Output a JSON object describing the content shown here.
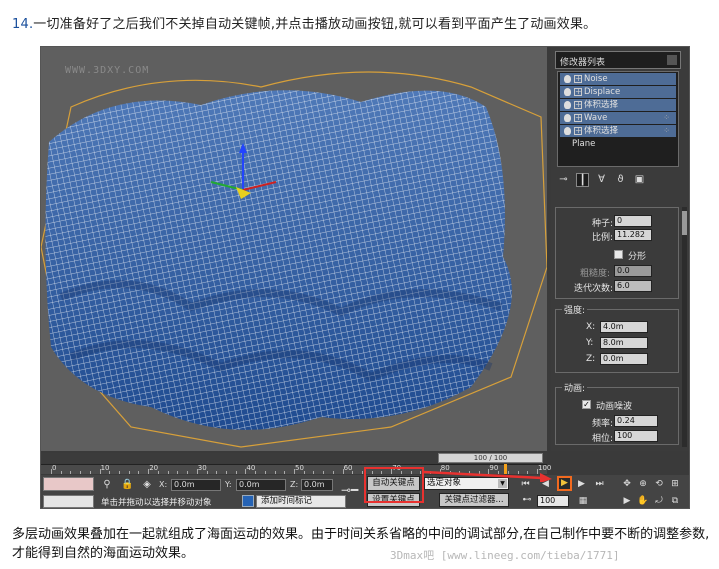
{
  "tutorial": {
    "step_number": "14.",
    "step_text": "一切准备好了之后我们不关掉自动关键帧,并点击播放动画按钮,就可以看到平面产生了动画效果。",
    "closing_text": "多层动画效果叠加在一起就组成了海面运动的效果。由于时间关系省略的中间的调试部分,在自己制作中要不断的调整参数,才能得到自然的海面运动效果。",
    "credit": "3Dmax吧 [www.lineeg.com/tieba/1771]"
  },
  "viewport": {
    "watermark": "WWW.3DXY.COM",
    "mesh_color": "#2f5ea8",
    "wire_color": "#ffffff"
  },
  "command_panel": {
    "object_name": "修改器列表",
    "stack": [
      {
        "label": "Noise",
        "selected": true
      },
      {
        "label": "Displace",
        "selected": false
      },
      {
        "label": "体积选择",
        "selected": false
      },
      {
        "label": "Wave",
        "selected": false
      },
      {
        "label": "体积选择",
        "selected": false
      },
      {
        "label": "Plane",
        "selected": false
      }
    ],
    "noise_params": {
      "seed_label": "种子:",
      "seed_value": "0",
      "scale_label": "比例:",
      "scale_value": "11.282",
      "fractal_label": "分形",
      "roughness_label": "粗糙度:",
      "roughness_value": "0.0",
      "iterations_label": "迭代次数:",
      "iterations_value": "6.0"
    },
    "strength": {
      "title": "强度:",
      "x_label": "X:",
      "x_value": "4.0m",
      "y_label": "Y:",
      "y_value": "8.0m",
      "z_label": "Z:",
      "z_value": "0.0m"
    },
    "animation": {
      "title": "动画:",
      "animate_noise_label": "动画噪波",
      "frequency_label": "频率:",
      "frequency_value": "0.24",
      "phase_label": "相位:",
      "phase_value": "100"
    }
  },
  "timeline": {
    "frame_indicator": "100 / 100",
    "ruler_numbers": [
      "0",
      "10",
      "20",
      "30",
      "40",
      "50",
      "60",
      "70",
      "80",
      "90",
      "100"
    ]
  },
  "statusbar": {
    "x_label": "X:",
    "x_value": "0.0m",
    "y_label": "Y:",
    "y_value": "0.0m",
    "z_label": "Z:",
    "z_value": "0.0m",
    "prompt": "单击并拖动以选择并移动对象",
    "add_time_tag": "添加时间标记",
    "auto_key": "自动关键点",
    "set_key": "设置关键点",
    "key_selection": "选定对象",
    "key_filters": "关键点过滤器...",
    "current_frame": "100"
  },
  "colors": {
    "highlight_red": "#e8312f",
    "play_orange": "#f26a1f"
  }
}
